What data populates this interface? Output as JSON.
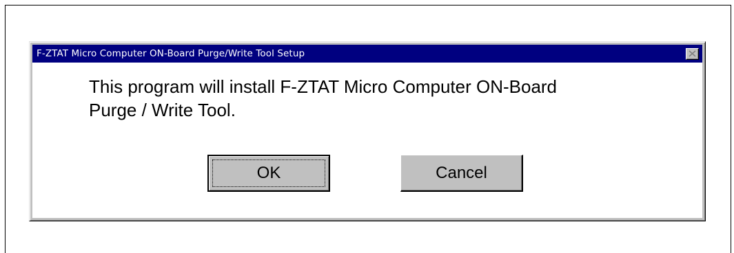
{
  "dialog": {
    "title": "F-ZTAT Micro Computer ON-Board Purge/Write Tool Setup",
    "close_icon": "close-icon",
    "message_line1": "This program will install F-ZTAT Micro Computer ON-Board",
    "message_line2": "Purge / Write Tool.",
    "ok_label": "OK",
    "cancel_label": "Cancel"
  },
  "colors": {
    "titlebar": "#000080",
    "face": "#c0c0c0",
    "content": "#ffffff"
  }
}
